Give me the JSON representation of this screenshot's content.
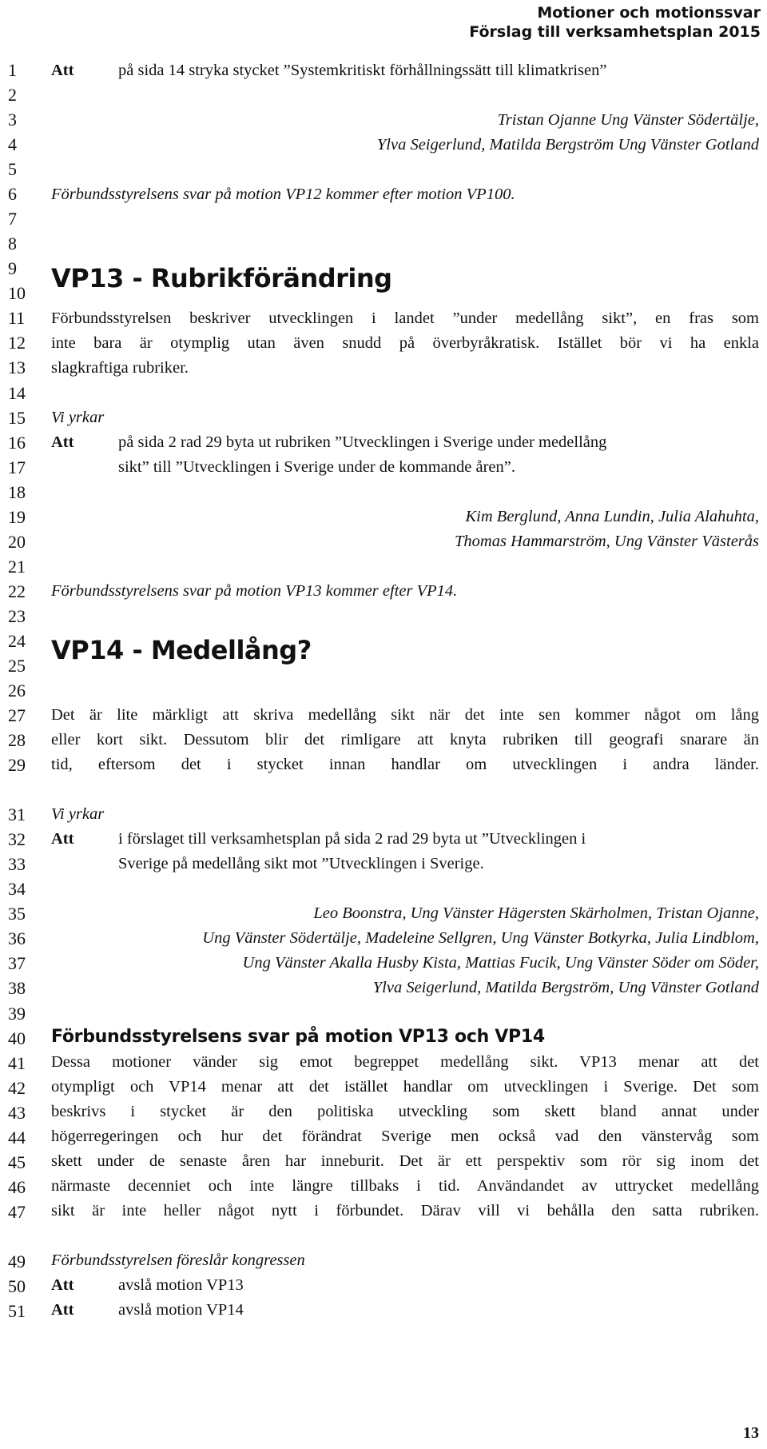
{
  "header": {
    "line1": "Motioner och motionssvar",
    "line2": "Förslag till verksamhetsplan 2015"
  },
  "line_numbers": [
    "1",
    "2",
    "3",
    "4",
    "5",
    "6",
    "7",
    "8",
    "9",
    "10",
    "11",
    "12",
    "13",
    "14",
    "15",
    "16",
    "17",
    "18",
    "19",
    "20",
    "21",
    "22",
    "23",
    "24",
    "25",
    "26",
    "27",
    "28",
    "29",
    "31",
    "32",
    "33",
    "34",
    "35",
    "36",
    "37",
    "38",
    "39",
    "40",
    "41",
    "42",
    "43",
    "44",
    "45",
    "46",
    "47",
    "49",
    "50",
    "51"
  ],
  "att_label": "Att",
  "prev_motion": {
    "att_text": "på sida 14 stryka stycket ”Systemkritiskt förhållningssätt till klimatkrisen”",
    "signers": [
      "Tristan Ojanne Ung Vänster Södertälje,",
      "Ylva Seigerlund, Matilda Bergström Ung Vänster Gotland"
    ],
    "response_note": "Förbundsstyrelsens svar på motion VP12 kommer efter motion VP100."
  },
  "vp13": {
    "title": "VP13 - Rubrikförändring",
    "body": [
      "Förbundsstyrelsen beskriver utvecklingen i landet ”under medellång sikt”, en fras som",
      "inte bara är otymplig utan även snudd på överbyråkratisk. Istället bör vi ha enkla",
      "slagkraftiga rubriker."
    ],
    "vi_yrkar": "Vi yrkar",
    "att_text": [
      "på sida 2 rad 29 byta ut rubriken ”Utvecklingen i Sverige under medellång",
      "sikt” till ”Utvecklingen i Sverige under de kommande åren”."
    ],
    "signers": [
      "Kim Berglund, Anna Lundin, Julia Alahuhta,",
      "Thomas Hammarström, Ung Vänster Västerås"
    ],
    "response_note": "Förbundsstyrelsens svar på motion VP13 kommer efter VP14."
  },
  "vp14": {
    "title": "VP14 - Medellång?",
    "body": [
      "Det är lite märkligt att skriva medellång sikt när det inte sen kommer något om lång",
      "eller kort sikt. Dessutom blir det rimligare att knyta rubriken till geografi snarare än",
      "tid, eftersom det i stycket innan handlar om utvecklingen i andra länder."
    ],
    "vi_yrkar": "Vi yrkar",
    "att_text": [
      "i förslaget till verksamhetsplan på sida 2 rad 29 byta ut ”Utvecklingen i",
      "Sverige på medellång sikt mot ”Utvecklingen i Sverige."
    ],
    "signers": [
      "Leo Boonstra, Ung Vänster Hägersten Skärholmen, Tristan Ojanne,",
      "Ung Vänster Södertälje, Madeleine Sellgren, Ung Vänster Botkyrka, Julia Lindblom,",
      "Ung Vänster Akalla Husby Kista, Mattias Fucik, Ung Vänster Söder om Söder,",
      "Ylva Seigerlund, Matilda Bergström, Ung Vänster Gotland"
    ]
  },
  "response": {
    "title": "Förbundsstyrelsens svar på motion VP13 och VP14",
    "body": [
      "Dessa motioner vänder sig emot begreppet medellång sikt. VP13 menar att det",
      "otympligt och VP14 menar att det istället handlar om utvecklingen i Sverige. Det som",
      "beskrivs i stycket är den politiska utveckling som skett bland annat under",
      "högerregeringen och hur det förändrat Sverige men också vad den vänstervåg som",
      "skett under de senaste åren har inneburit. Det är ett perspektiv som rör sig inom det",
      "närmaste decenniet och inte längre tillbaks i tid. Användandet av uttrycket medellång",
      "sikt är inte heller något nytt i förbundet. Därav vill vi behålla den satta rubriken."
    ],
    "proposal_intro": "Förbundsstyrelsen föreslår kongressen",
    "proposals": [
      "avslå motion VP13",
      "avslå motion VP14"
    ]
  },
  "page_number": "13"
}
